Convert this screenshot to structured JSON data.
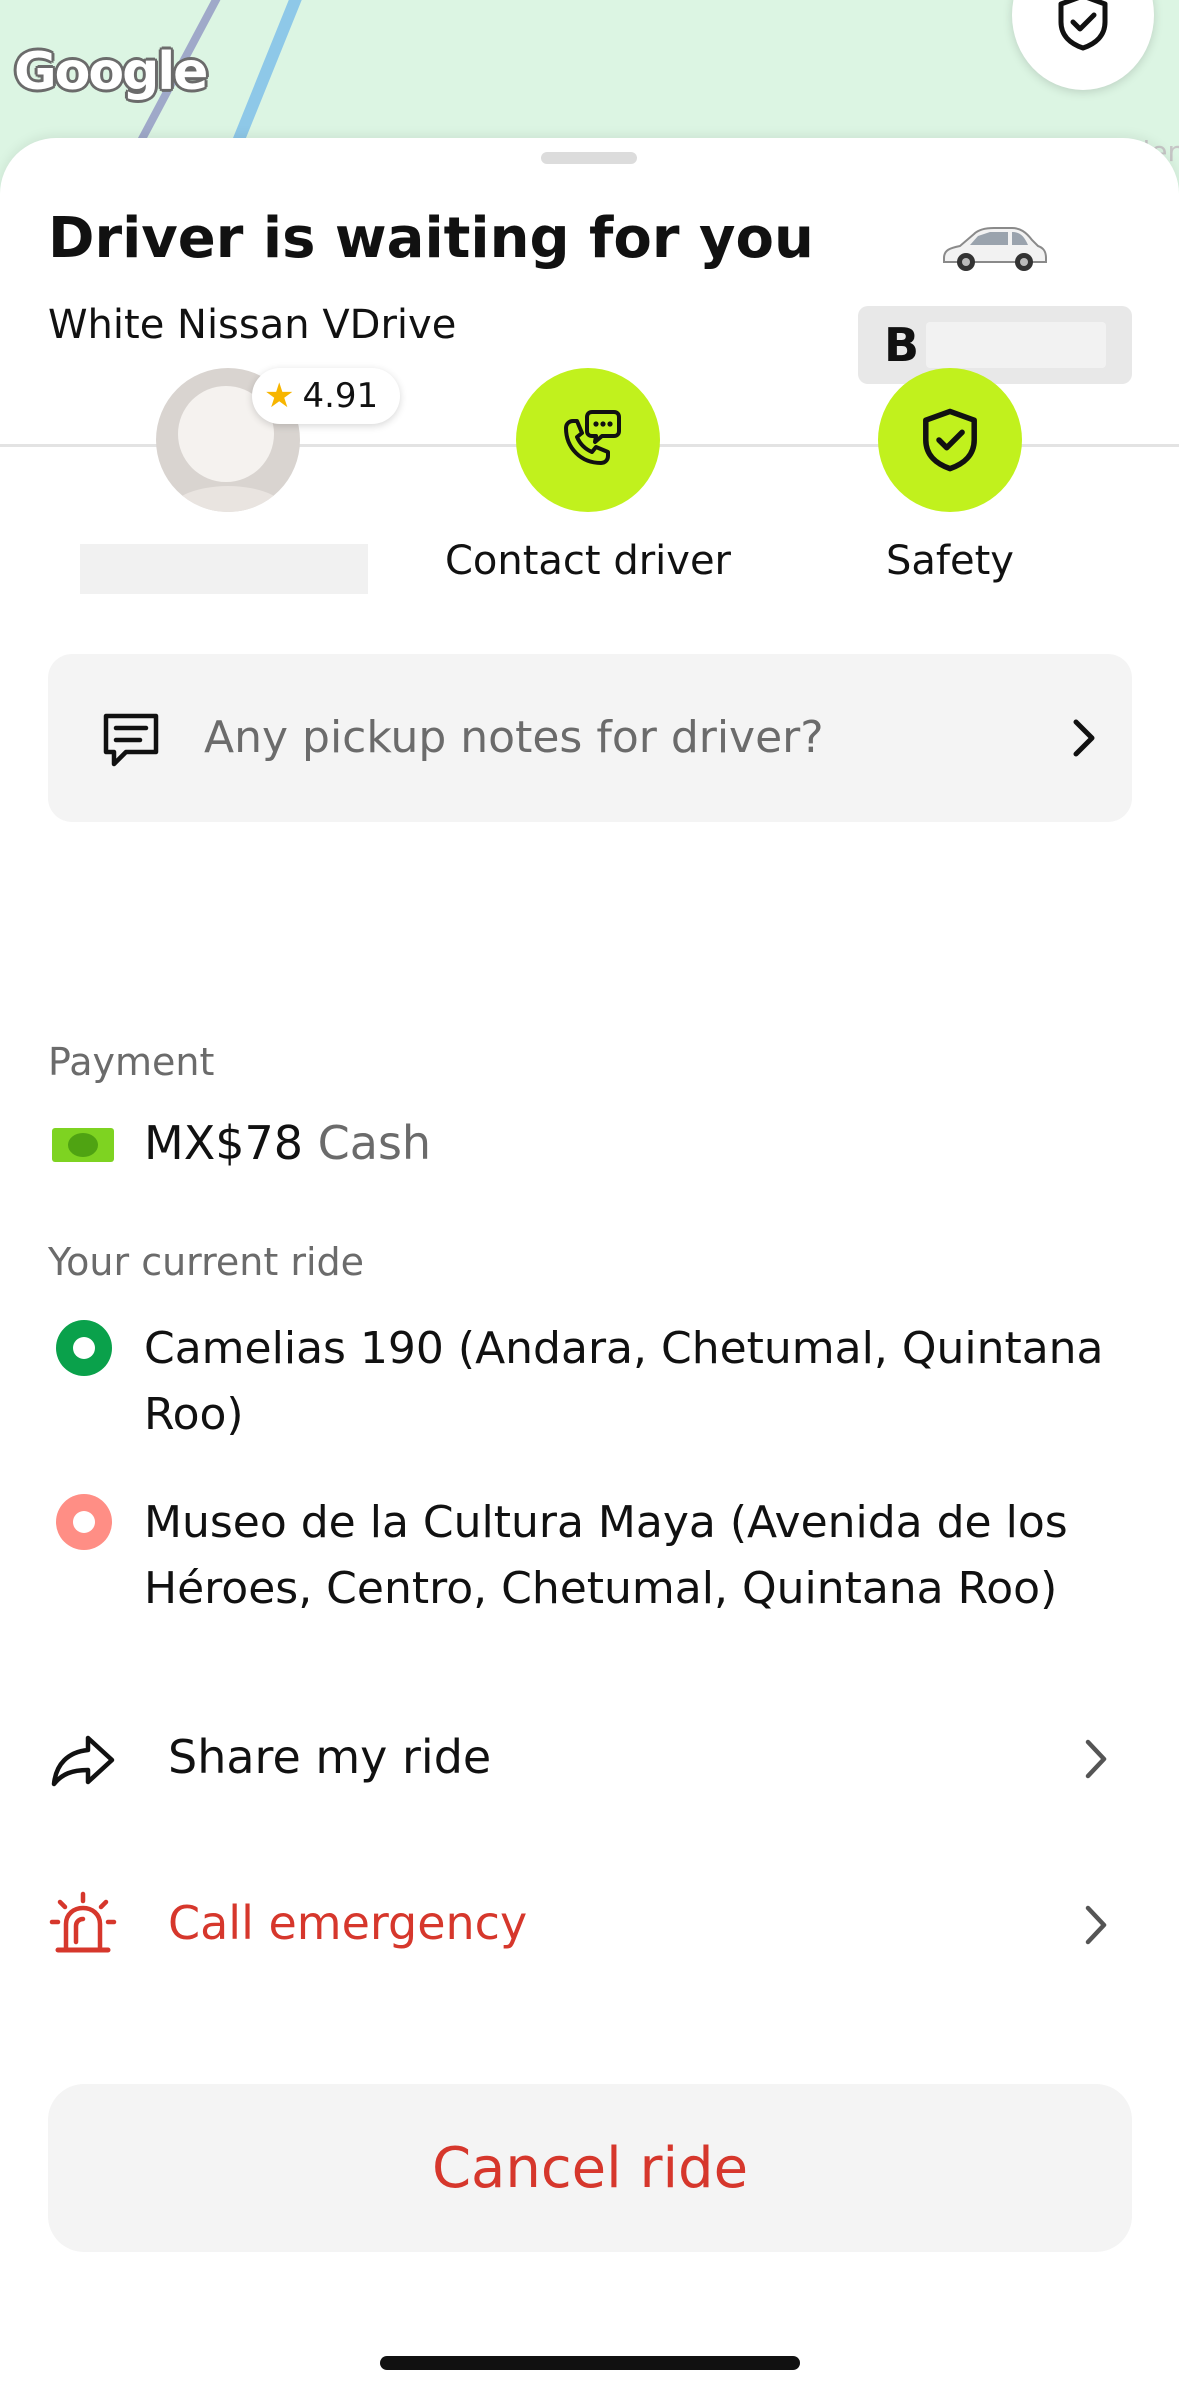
{
  "map": {
    "logo_text": "Google",
    "edge_text": "ler"
  },
  "header": {
    "title": "Driver is waiting for you",
    "vehicle": "White Nissan VDrive",
    "plate_visible": "B"
  },
  "driver": {
    "rating": "4.91"
  },
  "actions": {
    "contact_label": "Contact driver",
    "safety_label": "Safety"
  },
  "notes": {
    "placeholder": "Any pickup notes for driver?"
  },
  "payment": {
    "section_label": "Payment",
    "amount": "MX$78",
    "method": "Cash"
  },
  "ride": {
    "section_label": "Your current ride",
    "stops": [
      {
        "type": "pickup",
        "address": "Camelias 190 (Andara, Chetumal, Quintana Roo)"
      },
      {
        "type": "dropoff",
        "address": "Museo de la Cultura Maya (Avenida de los Héroes, Centro, Chetumal, Quintana Roo)"
      }
    ]
  },
  "options": {
    "share_label": "Share my ride",
    "emergency_label": "Call emergency"
  },
  "cancel": {
    "label": "Cancel ride"
  },
  "colors": {
    "accent_lime": "#c1f11d",
    "danger_red": "#d6372c",
    "pickup_green": "#0aa14b",
    "dropoff_pink": "#ff8e85"
  },
  "icons": {
    "map_safety": "shield-check-icon",
    "car": "car-icon",
    "contact": "phone-chat-icon",
    "safety": "shield-check-icon",
    "notes": "message-icon",
    "payment": "cash-icon",
    "share": "share-arrow-icon",
    "emergency": "siren-icon",
    "chevron": "chevron-right-icon"
  }
}
